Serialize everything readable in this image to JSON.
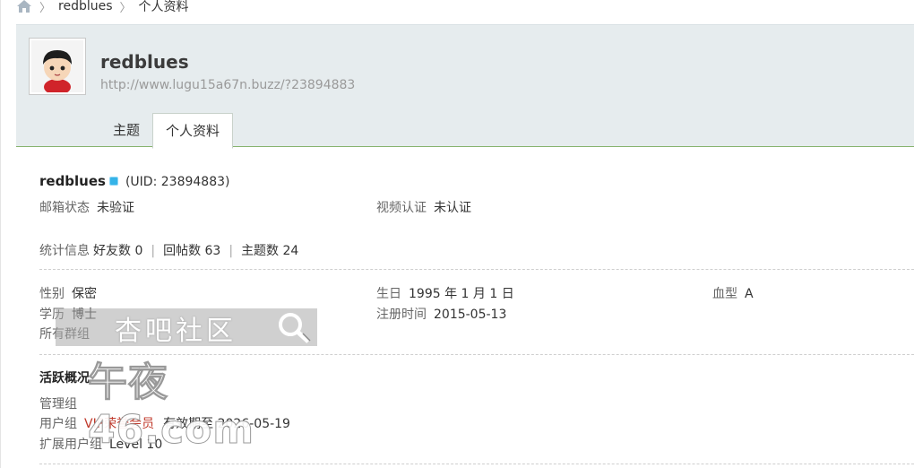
{
  "breadcrumb": {
    "items": [
      "redblues",
      "个人资料"
    ],
    "separator": "〉"
  },
  "profile": {
    "username": "redblues",
    "homepage": "http://www.lugu15a67n.buzz/?23894883"
  },
  "tabs": [
    {
      "label": "主题",
      "active": false
    },
    {
      "label": "个人资料",
      "active": true
    }
  ],
  "info": {
    "name": "redblues",
    "uid": "(UID: 23894883)",
    "email_status_label": "邮箱状态",
    "email_status_value": "未验证",
    "video_auth_label": "视频认证",
    "video_auth_value": "未认证",
    "stats_label": "统计信息",
    "friends": "好友数 0",
    "replies": "回帖数 63",
    "threads": "主题数 24",
    "gender_label": "性别",
    "gender_value": "保密",
    "birthday_label": "生日",
    "birthday_value": "1995 年 1 月 1 日",
    "blood_label": "血型",
    "blood_value": "A",
    "education_label": "学历",
    "education_value": "博士",
    "register_label": "注册时间",
    "register_value": "2015-05-13",
    "groups_label": "所有群组",
    "activity_title": "活跃概况",
    "admin_group_label": "管理组",
    "user_group_label": "用户组",
    "user_group_value": "VIP荣誉会员",
    "expiry": "有效期至 2026-05-19",
    "ext_group_label": "扩展用户组",
    "ext_group_value": "Level 10"
  },
  "watermark": {
    "line1": "杏吧社区",
    "line2": "午夜46.com"
  },
  "colors": {
    "header_bg": "#e6ecee",
    "header_border": "#86b26d",
    "online_dot": "#35b3e8",
    "vip": "#c0392b"
  }
}
